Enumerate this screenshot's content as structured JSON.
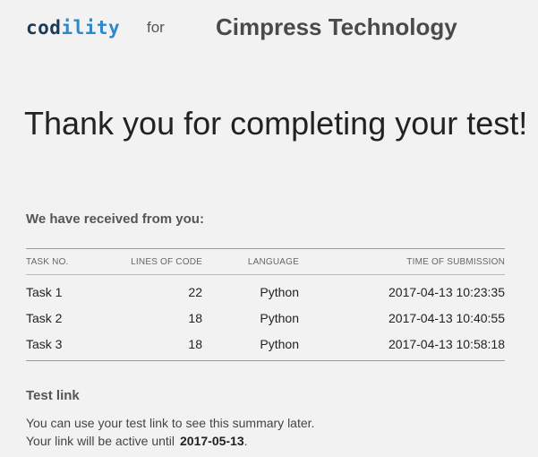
{
  "header": {
    "logo_part1": "cod",
    "logo_part2": "ility",
    "for_label": "for",
    "company_name": "Cimpress Technology"
  },
  "main": {
    "headline": "Thank you for completing your test!",
    "received_heading": "We have received from you:",
    "table": {
      "columns": [
        "TASK NO.",
        "LINES OF CODE",
        "LANGUAGE",
        "TIME OF SUBMISSION"
      ],
      "rows": [
        [
          "Task 1",
          "22",
          "Python",
          "2017-04-13 10:23:35"
        ],
        [
          "Task 2",
          "18",
          "Python",
          "2017-04-13 10:40:55"
        ],
        [
          "Task 3",
          "18",
          "Python",
          "2017-04-13 10:58:18"
        ]
      ]
    },
    "test_link": {
      "title": "Test link",
      "line1": "You can use your test link to see this summary later.",
      "line2_prefix": "Your link will be active until",
      "active_until": "2017-05-13",
      "line2_suffix": "."
    }
  },
  "colors": {
    "background": "#f2f2f2",
    "logo_dark": "#1a3a5a",
    "logo_accent": "#2e88c8"
  }
}
